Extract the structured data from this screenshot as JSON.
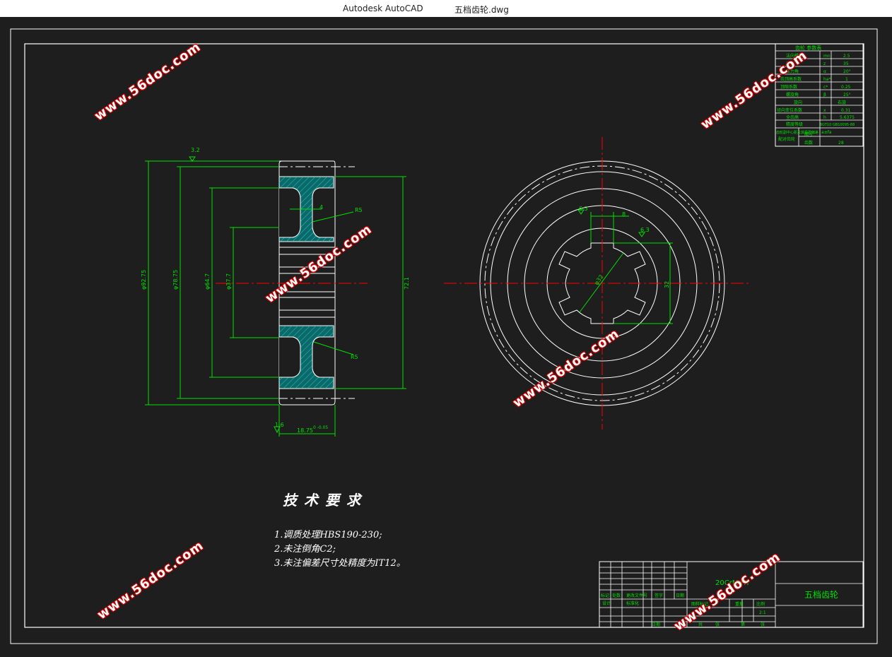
{
  "window": {
    "app_name": "Autodesk AutoCAD",
    "file_name": "五档齿轮.dwg"
  },
  "drawing": {
    "dims_left": {
      "d1": "φ92.75",
      "d2": "φ78.75",
      "d3": "φ64.7",
      "d4": "φ37.7",
      "d5": "72.1",
      "roughness_top": "3.2",
      "roughness_bottom": "1.6",
      "width": "18.75",
      "width_tol": "0 -0.05",
      "web_thickness": "4",
      "fillet1": "R5",
      "fillet2": "R5"
    },
    "dims_right": {
      "key_width": "8",
      "spline_dia": "φ32",
      "spline_len": "32",
      "rough1": "6.3",
      "rough2": "6.3"
    }
  },
  "tech_req": {
    "title": "技术要求",
    "lines": [
      "1.调质处理HBS190-230;",
      "2.未注倒角C2;",
      "3.未注偏差尺寸处精度为IT12。"
    ]
  },
  "param_table": {
    "title": "齿轮 参数表",
    "rows": [
      {
        "name": "法向模数",
        "sym": "mn",
        "val": "2.5"
      },
      {
        "name": "齿数",
        "sym": "z",
        "val": "35"
      },
      {
        "name": "压力角",
        "sym": "α",
        "val": "20°"
      },
      {
        "name": "齿顶高系数",
        "sym": "ha*",
        "val": "1"
      },
      {
        "name": "顶隙系数",
        "sym": "c*",
        "val": "0.25"
      },
      {
        "name": "螺旋角",
        "sym": "β",
        "val": "25°"
      },
      {
        "name": "旋向",
        "sym": "",
        "val": "右旋"
      },
      {
        "name": "径向变位系数",
        "sym": "x",
        "val": "0.31"
      },
      {
        "name": "全齿高",
        "sym": "h",
        "val": "5.6375"
      },
      {
        "name": "精度等级",
        "sym": "",
        "val": "8GT10 GB10095-88"
      },
      {
        "name": "齿轮副中心距及其极限偏差",
        "sym": "a±fa",
        "val": ""
      }
    ],
    "mating": {
      "label": "配对齿轮",
      "r1": "图号",
      "r2": "齿数",
      "r2_val": "28"
    }
  },
  "title_block": {
    "material": "20CrMnTi",
    "part_name": "五档齿轮",
    "scale": "2:1",
    "headers": [
      "标记",
      "处数",
      "更改文件号",
      "签字",
      "日期"
    ],
    "row2": [
      "设计",
      "标准化"
    ],
    "approve": [
      "图样标记",
      "重量",
      "比例"
    ],
    "sheet": [
      "共",
      "张",
      "第",
      "张"
    ],
    "date_label": "日期"
  },
  "watermarks": [
    "www.56doc.com",
    "www.56doc.com",
    "www.56doc.com",
    "www.56doc.com",
    "www.56doc.com",
    "www.56doc.com",
    "www.56doc.com"
  ],
  "colors": {
    "line": "#ffffff",
    "dim": "#00ff00",
    "center": "#ff0000",
    "hatch": "#00a0a0",
    "background": "#1e1e1e"
  }
}
